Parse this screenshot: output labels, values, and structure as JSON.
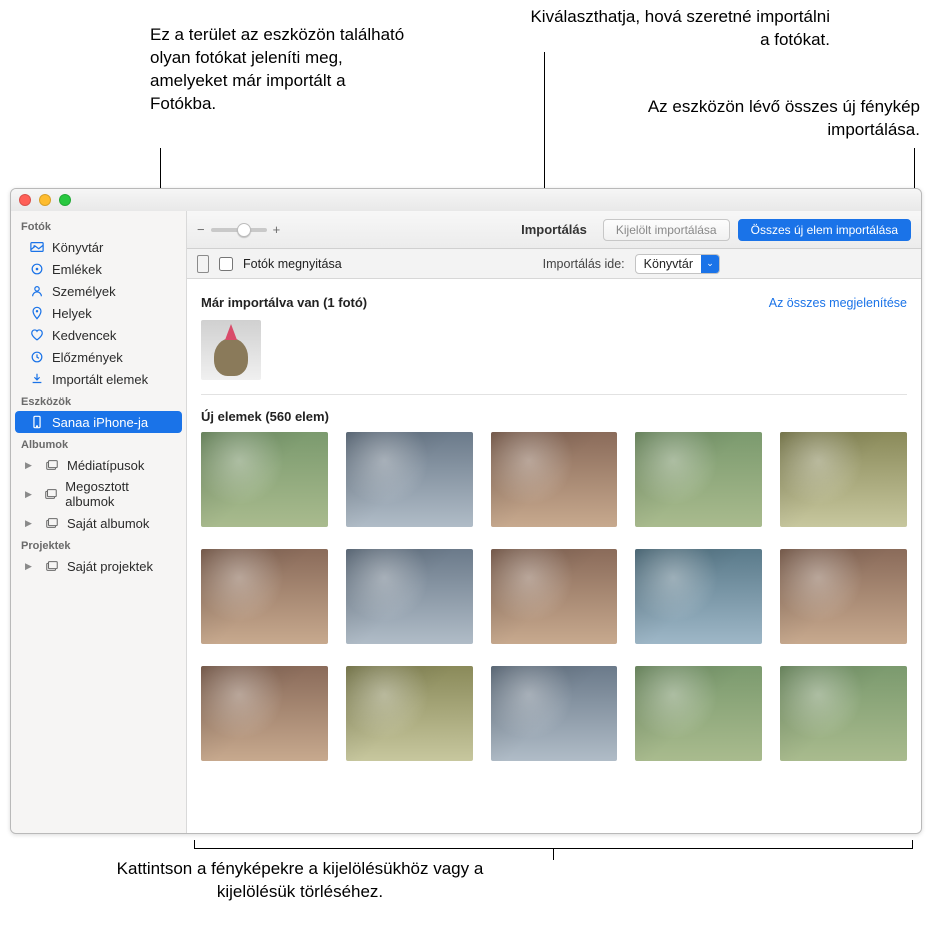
{
  "callouts": {
    "already_imported": "Ez a terület az eszközön található olyan fotókat jeleníti meg, amelyeket már importált a Fotókba.",
    "choose_dest": "Kiválaszthatja, hová szeretné importálni a fotókat.",
    "import_all": "Az eszközön lévő összes új fénykép importálása.",
    "click_select": "Kattintson a fényképekre a kijelölésükhöz vagy a kijelölésük törléséhez."
  },
  "toolbar": {
    "title": "Importálás",
    "import_selected": "Kijelölt importálása",
    "import_all_new": "Összes új elem importálása",
    "zoom_minus": "−",
    "zoom_plus": "+"
  },
  "optionsbar": {
    "open_photos": "Fotók megnyitása",
    "import_to_label": "Importálás ide:",
    "destination": "Könyvtár"
  },
  "sidebar": {
    "sections": {
      "photos": "Fotók",
      "devices": "Eszközök",
      "albums": "Albumok",
      "projects": "Projektek"
    },
    "items": {
      "library": "Könyvtár",
      "memories": "Emlékek",
      "people": "Személyek",
      "places": "Helyek",
      "favorites": "Kedvencek",
      "recents": "Előzmények",
      "imports": "Importált elemek",
      "device1": "Sanaa iPhone-ja",
      "mediatypes": "Médiatípusok",
      "shared": "Megosztott albumok",
      "myalbums": "Saját albumok",
      "myprojects": "Saját projektek"
    }
  },
  "content": {
    "already_header": "Már importálva van (1 fotó)",
    "show_all": "Az összes megjelenítése",
    "new_header": "Új elemek (560 elem)"
  }
}
